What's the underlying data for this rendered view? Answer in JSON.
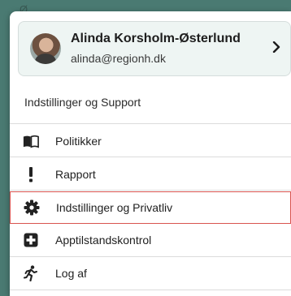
{
  "background": {
    "partial_text": "Ø..."
  },
  "user": {
    "name": "Alinda Korsholm-Østerlund",
    "email": "alinda@regionh.dk",
    "chevron": "›"
  },
  "section_title": "Indstillinger og Support",
  "menu": {
    "items": [
      {
        "label": "Politikker",
        "icon": "book-icon"
      },
      {
        "label": "Rapport",
        "icon": "exclamation-icon"
      },
      {
        "label": "Indstillinger og Privatliv",
        "icon": "gear-icon",
        "selected": true
      },
      {
        "label": "Apptilstandskontrol",
        "icon": "medical-cross-icon"
      },
      {
        "label": "Log af",
        "icon": "running-person-icon"
      }
    ]
  },
  "colors": {
    "selected_outline": "#d9534f",
    "backdrop": "#4a7a72",
    "card_background": "#eef5f3"
  }
}
